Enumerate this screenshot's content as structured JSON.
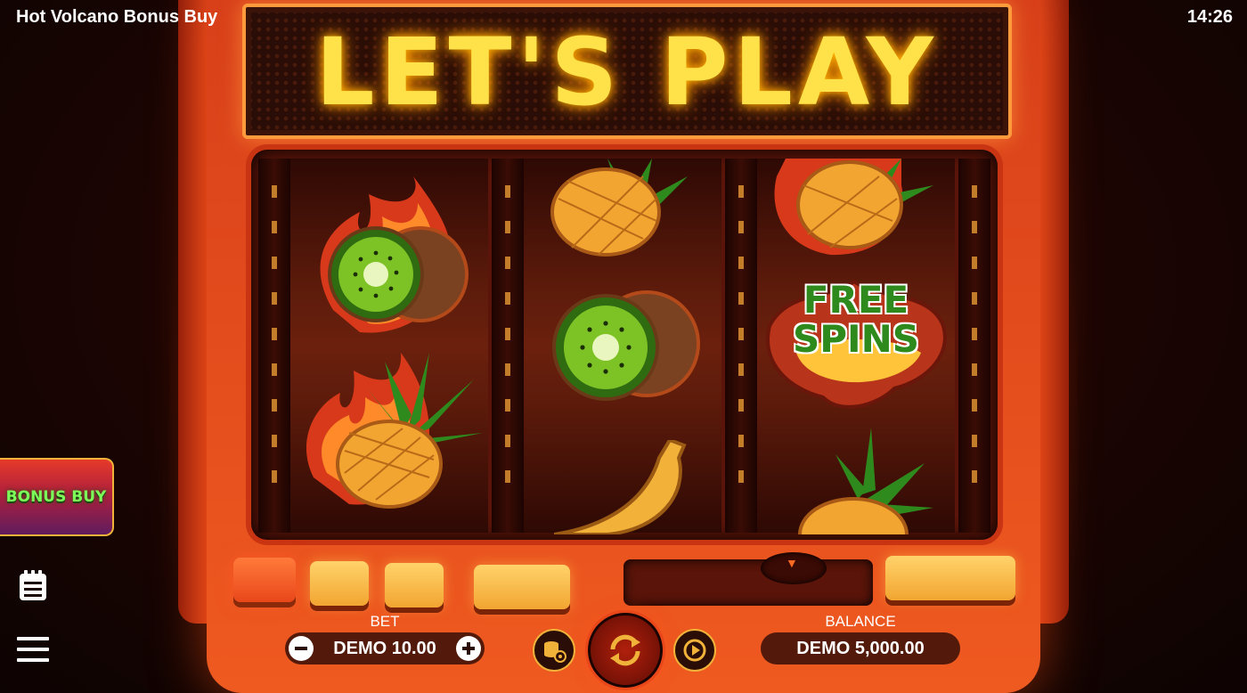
{
  "header": {
    "game_title": "Hot Volcano Bonus Buy",
    "clock": "14:26"
  },
  "marquee": {
    "text": "LET'S PLAY"
  },
  "reels": {
    "reel1": [
      "flaming-kiwi",
      "flaming-pineapple"
    ],
    "reel2": [
      "pineapple",
      "kiwi",
      "banana"
    ],
    "reel3": [
      "flaming-pineapple",
      "free-spins-scatter",
      "pineapple"
    ],
    "free_spins_line1": "FREE",
    "free_spins_line2": "SPINS"
  },
  "side": {
    "bonus_buy_label": "BONUS BUY",
    "paytable_icon": "paytable-icon",
    "menu_icon": "hamburger-menu-icon"
  },
  "controls": {
    "bet_label": "BET",
    "bet_value": "DEMO 10.00",
    "balance_label": "BALANCE",
    "balance_value": "DEMO 5,000.00",
    "decrease_icon": "minus-icon",
    "increase_icon": "plus-icon",
    "bet_settings_icon": "coins-gear-icon",
    "spin_icon": "spin-arrows-icon",
    "autoplay_icon": "autoplay-icon"
  },
  "colors": {
    "cabinet": "#e14a1c",
    "marquee_text": "#ffe24a",
    "accent_gold": "#f1b23a",
    "bonus_buy_text": "#7dff5a"
  }
}
